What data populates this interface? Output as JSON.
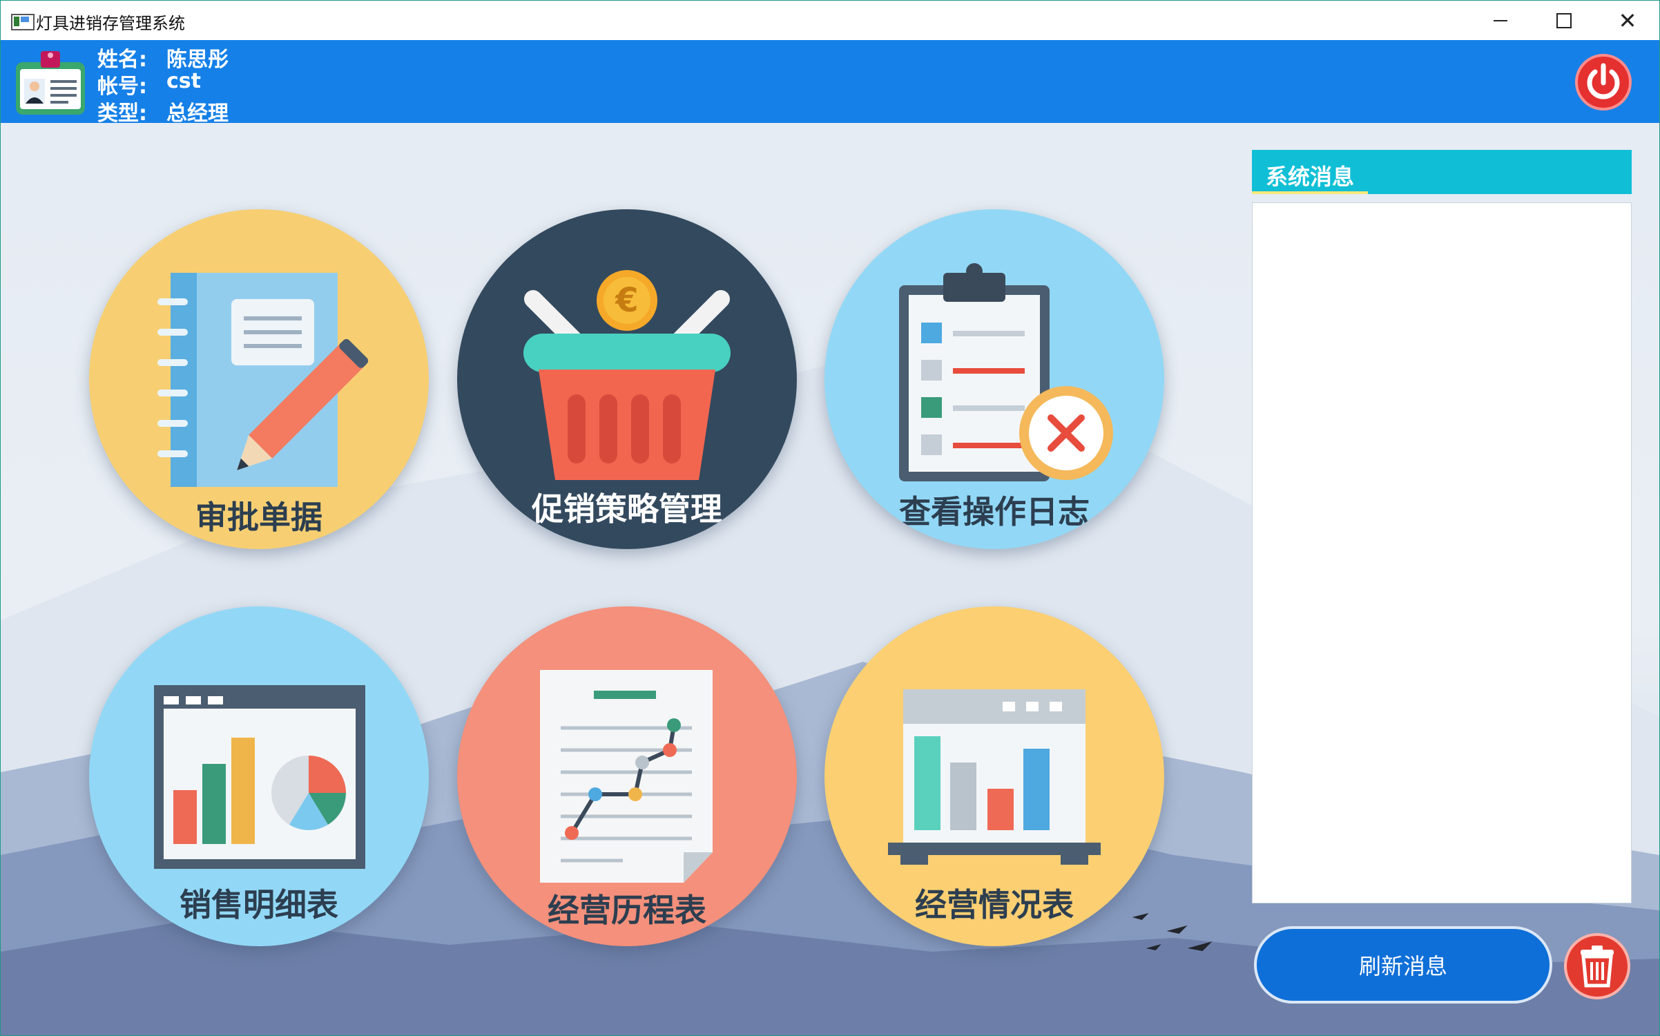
{
  "window": {
    "title": "灯具进销存管理系统"
  },
  "user": {
    "name_label": "姓名:",
    "name": "陈思彤",
    "account_label": "帐号:",
    "account": "cst",
    "type_label": "类型:",
    "type": "总经理"
  },
  "tiles": [
    {
      "label": "审批单据",
      "icon": "notebook-pencil-icon"
    },
    {
      "label": "促销策略管理",
      "icon": "shopping-basket-euro-icon"
    },
    {
      "label": "查看操作日志",
      "icon": "clipboard-checklist-icon"
    },
    {
      "label": "销售明细表",
      "icon": "bar-pie-chart-icon"
    },
    {
      "label": "经营历程表",
      "icon": "document-line-chart-icon"
    },
    {
      "label": "经营情况表",
      "icon": "presentation-bar-chart-icon"
    }
  ],
  "messages": {
    "title": "系统消息",
    "refresh_label": "刷新消息"
  },
  "colors": {
    "header": "#1580e8",
    "accent_cyan": "#10bfd6",
    "button_blue": "#0f6fd8",
    "power_red": "#e53030",
    "tile_yellow": "#f7cf72",
    "tile_navy": "#33495e",
    "tile_sky": "#92d8f6",
    "tile_salmon": "#f4907b"
  }
}
